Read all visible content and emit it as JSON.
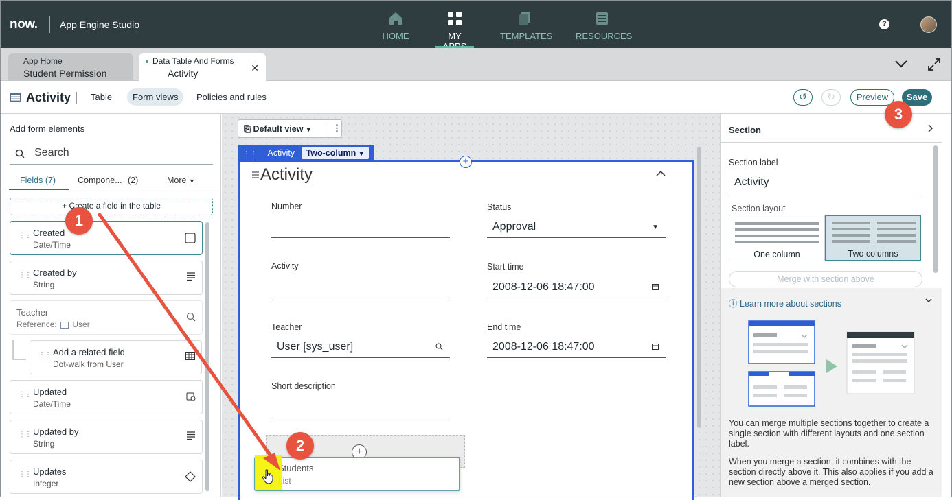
{
  "header": {
    "logo": "now.",
    "app_title": "App Engine Studio",
    "nav": [
      {
        "label": "HOME",
        "icon": "home-icon",
        "active": false
      },
      {
        "label": "MY APPS",
        "icon": "grid-icon",
        "active": true
      },
      {
        "label": "TEMPLATES",
        "icon": "templates-icon",
        "active": false
      },
      {
        "label": "RESOURCES",
        "icon": "resources-icon",
        "active": false
      }
    ],
    "help": "?"
  },
  "tabs": [
    {
      "title": "App Home",
      "subtitle": "Student Permission"
    },
    {
      "title": "Data Table And Forms",
      "subtitle": "Activity"
    }
  ],
  "toolbar": {
    "title": "Activity",
    "links": [
      "Table",
      "Form views",
      "Policies and rules"
    ],
    "preview": "Preview",
    "save": "Save"
  },
  "left_panel": {
    "title": "Add form elements",
    "search_placeholder": "Search",
    "tabs": [
      "Fields (7)",
      "Compone...",
      "(2)",
      "More"
    ],
    "create_button": "+ Create a field in the table",
    "fields": [
      {
        "name": "Created",
        "type": "Date/Time",
        "icon": "checkbox-icon"
      },
      {
        "name": "Created by",
        "type": "String",
        "icon": "text-lines-icon"
      },
      {
        "name": "Teacher",
        "type": "Reference:",
        "ref": "User",
        "icon": "search-icon"
      },
      {
        "name": "Add a related field",
        "type": "Dot-walk from User",
        "icon": "table-icon"
      },
      {
        "name": "Updated",
        "type": "Date/Time",
        "icon": "calendar-clock-icon"
      },
      {
        "name": "Updated by",
        "type": "String",
        "icon": "text-lines-icon"
      },
      {
        "name": "Updates",
        "type": "Integer",
        "icon": "diamond-icon"
      }
    ]
  },
  "canvas": {
    "view": "Default view",
    "section_tag": {
      "label": "Activity",
      "layout": "Two-column"
    },
    "section_title": "Activity",
    "fields": {
      "number_label": "Number",
      "status_label": "Status",
      "status_value": "Approval",
      "activity_label": "Activity",
      "start_label": "Start time",
      "start_value": "2008-12-06 18:47:00",
      "teacher_label": "Teacher",
      "teacher_value": "User [sys_user]",
      "end_label": "End time",
      "end_value": "2008-12-06 18:47:00",
      "short_label": "Short description"
    },
    "drag_item": {
      "name": "Students",
      "type": "List"
    }
  },
  "right_panel": {
    "title": "Section",
    "section_label": "Section label",
    "section_value": "Activity",
    "section_layout": "Section layout",
    "one_column": "One column",
    "two_columns": "Two columns",
    "merge": "Merge with section above",
    "learn_more": "Learn more about sections",
    "text1": "You can merge multiple sections together to create a single section with different layouts and one section label.",
    "text2": "When you merge a section, it combines with the section directly above it. This also applies if you add a new section above a merged section."
  },
  "annotations": [
    "1",
    "2",
    "3"
  ],
  "colors": {
    "header_bg": "#2f3d41",
    "accent": "#2f6f7a",
    "badge": "#e8533f",
    "section_blue": "#2f5ed6",
    "arrow": "#e8533f"
  }
}
